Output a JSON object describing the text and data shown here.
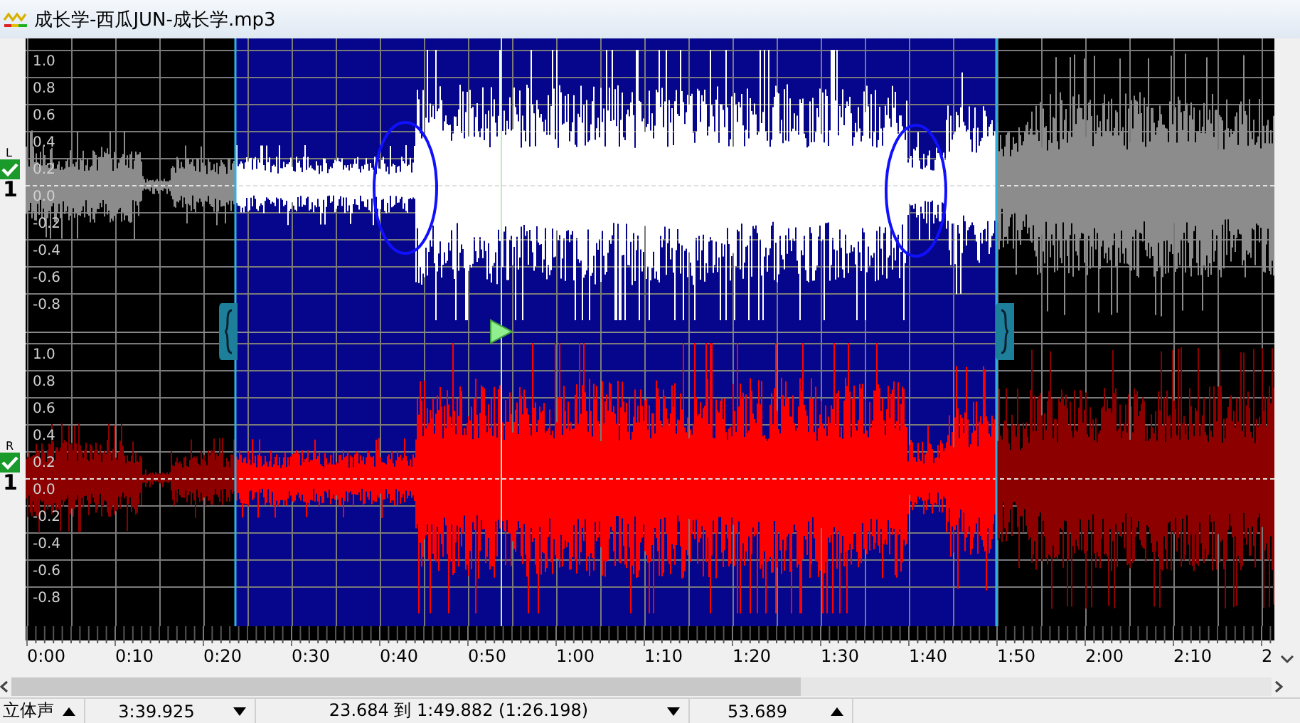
{
  "window": {
    "title": "成长学-西瓜JUN-成长学.mp3"
  },
  "channels": [
    {
      "label": "L",
      "enabled": true,
      "number": "1",
      "color": "#ffffff",
      "axis_labels": [
        "1.0",
        "0.8",
        "0.6",
        "0.4",
        "0.2",
        "0.0",
        "-0.2",
        "-0.4",
        "-0.6",
        "-0.8"
      ]
    },
    {
      "label": "R",
      "enabled": true,
      "number": "1",
      "color": "#ff0000",
      "axis_labels": [
        "1.0",
        "0.8",
        "0.6",
        "0.4",
        "0.2",
        "0.0",
        "-0.2",
        "-0.4",
        "-0.6",
        "-0.8"
      ]
    }
  ],
  "ruler": {
    "labels": [
      "0:00",
      "0:10",
      "0:20",
      "0:30",
      "0:40",
      "0:50",
      "1:00",
      "1:10",
      "1:20",
      "1:30",
      "1:40",
      "1:50",
      "2:00",
      "2:10",
      "2"
    ]
  },
  "status_bar": {
    "channel_mode": "立体声",
    "duration": "3:39.925",
    "selection": "23.684 到 1:49.882 (1:26.198)",
    "view_value": "53.689"
  }
}
